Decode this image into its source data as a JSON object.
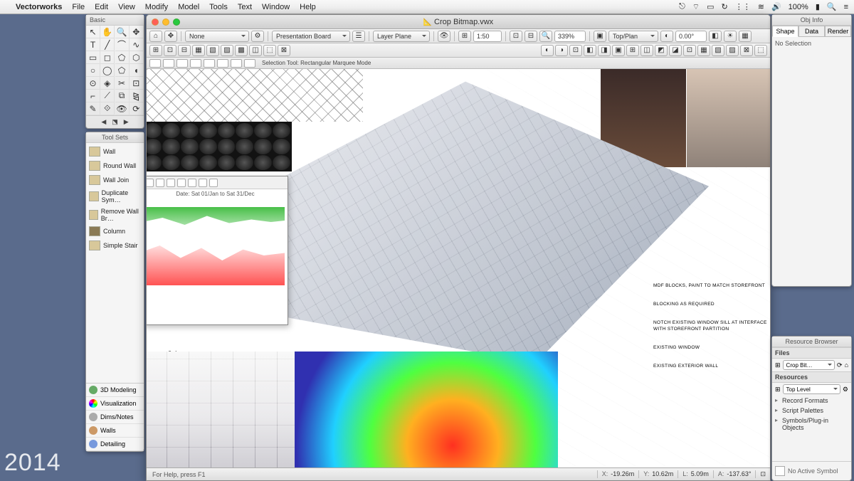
{
  "menubar": {
    "app": "Vectorworks",
    "items": [
      "File",
      "Edit",
      "View",
      "Modify",
      "Model",
      "Tools",
      "Text",
      "Window",
      "Help"
    ],
    "battery": "100%"
  },
  "palettes": {
    "basic": {
      "title": "Basic"
    },
    "toolsets": {
      "title": "Tool Sets",
      "items": [
        "Wall",
        "Round Wall",
        "Wall Join",
        "Duplicate Sym…",
        "Remove Wall Br…",
        "Column",
        "Simple Stair"
      ],
      "bottom_tabs": [
        "3D Modeling",
        "Visualization",
        "Dims/Notes",
        "Walls",
        "Detailing"
      ]
    },
    "objinfo": {
      "title": "Obj Info",
      "tabs": [
        "Shape",
        "Data",
        "Render"
      ],
      "active_tab": 0,
      "status": "No Selection"
    },
    "resources": {
      "title": "Resource Browser",
      "files_label": "Files",
      "file_selected": "Crop Bit…",
      "resources_label": "Resources",
      "level_selected": "Top Level",
      "items": [
        "Record Formats",
        "Script Palettes",
        "Symbols/Plug-in Objects"
      ],
      "footer": "No Active Symbol"
    }
  },
  "document": {
    "title": "Crop Bitmap.vwx",
    "toolbar": {
      "class_drop": "None",
      "layer_drop": "Presentation Board",
      "plane_drop": "Layer Plane",
      "scale": "1:50",
      "zoom": "339%",
      "view": "Top/Plan",
      "rotation": "0.00°"
    },
    "mode_bar": "Selection Tool: Rectangular Marquee Mode",
    "canvas_text": {
      "cooling": "Cooling",
      "chart_date": "Date: Sat 01/Jan to Sat 31/Dec",
      "detail_notes": [
        "MDF BLOCKS, PAINT TO MATCH STOREFRONT",
        "BLOCKING AS REQUIRED",
        "NOTCH EXISTING WINDOW SILL AT INTERFACE WITH STOREFRONT PARTITION",
        "EXISTING WINDOW",
        "EXISTING EXTERIOR WALL"
      ]
    },
    "footer": {
      "help": "For Help, press F1",
      "coords": {
        "x": {
          "label": "X:",
          "val": "-19.26m"
        },
        "y": {
          "label": "Y:",
          "val": "10.62m"
        },
        "l": {
          "label": "L:",
          "val": "5.09m"
        },
        "a": {
          "label": "A:",
          "val": "-137.63°"
        }
      }
    }
  },
  "watermark": "2014"
}
